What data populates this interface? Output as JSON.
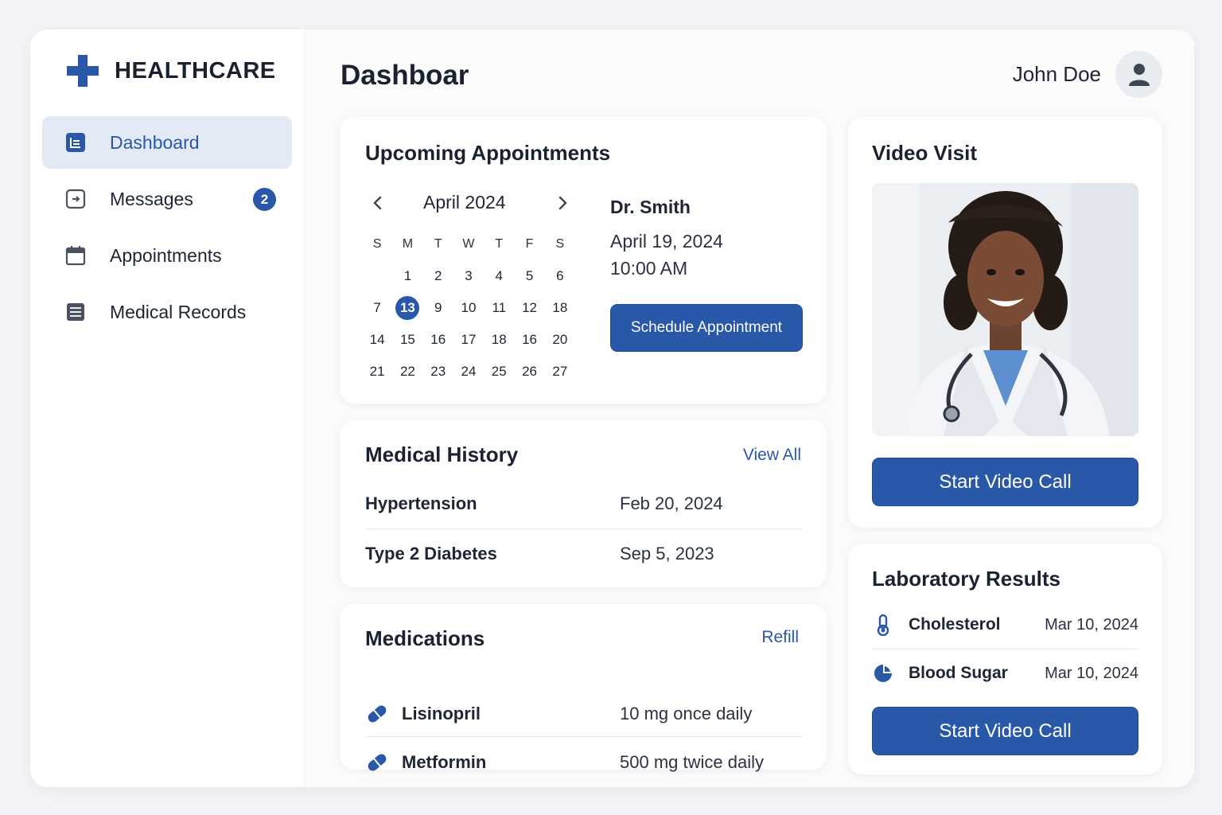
{
  "brand": {
    "name": "HEALTHCARE",
    "icon": "medical-cross-icon",
    "color": "#2a58a8"
  },
  "sidebar": {
    "items": [
      {
        "label": "Dashboard",
        "icon": "dashboard-icon",
        "active": true
      },
      {
        "label": "Messages",
        "icon": "message-icon",
        "badge": "2"
      },
      {
        "label": "Appointments",
        "icon": "calendar-icon"
      },
      {
        "label": "Medical Records",
        "icon": "records-icon"
      }
    ]
  },
  "header": {
    "title": "Dashboar",
    "user_name": "John Doe",
    "avatar_icon": "user-icon"
  },
  "appointments": {
    "title": "Upcoming Appointments",
    "calendar": {
      "month": "April 2024",
      "weekdays": [
        "S",
        "M",
        "T",
        "W",
        "T",
        "F",
        "S"
      ],
      "weeks": [
        [
          "",
          "1",
          "2",
          "3",
          "4",
          "5",
          "6"
        ],
        [
          "7",
          "13",
          "9",
          "10",
          "11",
          "12",
          "18"
        ],
        [
          "14",
          "15",
          "16",
          "17",
          "18",
          "16",
          "20"
        ],
        [
          "21",
          "22",
          "23",
          "24",
          "25",
          "26",
          "27"
        ]
      ],
      "selected": "13"
    },
    "doctor": "Dr. Smith",
    "date": "April 19, 2024",
    "time": "10:00 AM",
    "button": "Schedule Appointment"
  },
  "medical_history": {
    "title": "Medical History",
    "link": "View All",
    "items": [
      {
        "name": "Hypertension",
        "date": "Feb 20, 2024"
      },
      {
        "name": "Type 2 Diabetes",
        "date": "Sep 5, 2023"
      }
    ]
  },
  "medications": {
    "title": "Medications",
    "link": "Refill",
    "items": [
      {
        "name": "Lisinopril",
        "dose": "10 mg once daily",
        "icon": "pill-icon"
      },
      {
        "name": "Metformin",
        "dose": "500 mg twice daily",
        "icon": "pill-icon"
      }
    ]
  },
  "video_visit": {
    "title": "Video Visit",
    "button": "Start Video Call"
  },
  "lab_results": {
    "title": "Laboratory Results",
    "items": [
      {
        "name": "Cholesterol",
        "date": "Mar 10, 2024",
        "icon": "thermometer-icon"
      },
      {
        "name": "Blood Sugar",
        "date": "Mar 10, 2024",
        "icon": "pie-chart-icon"
      }
    ],
    "button": "Start Video Call"
  }
}
